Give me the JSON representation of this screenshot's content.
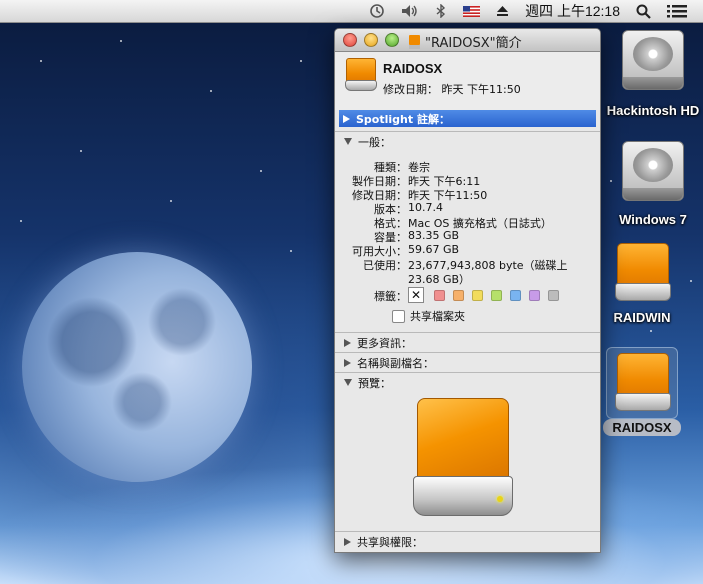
{
  "menubar": {
    "icons": [
      "time-machine-icon",
      "volume-icon",
      "bluetooth-icon",
      "us-flag-icon",
      "eject-icon",
      "spotlight-search-icon",
      "notification-list-icon"
    ],
    "clock": "週四 上午12:18"
  },
  "desktop": {
    "icons": [
      {
        "label": "Hackintosh HD",
        "kind": "internal-hdd"
      },
      {
        "label": "Windows 7",
        "kind": "internal-hdd"
      },
      {
        "label": "RAIDWIN",
        "kind": "external-drive"
      },
      {
        "label": "RAIDOSX",
        "kind": "external-drive",
        "selected": true
      }
    ]
  },
  "window": {
    "title": "\"RAIDOSX\"簡介",
    "name": "RAIDOSX",
    "modified": "修改日期： 昨天 下午11:50",
    "spotlight": "Spotlight 註解：",
    "general": {
      "header": "一般：",
      "rows": [
        {
          "k": "種類：",
          "v": "卷宗"
        },
        {
          "k": "製作日期：",
          "v": "昨天 下午6:11"
        },
        {
          "k": "修改日期：",
          "v": "昨天 下午11:50"
        },
        {
          "k": "版本：",
          "v": "10.7.4"
        },
        {
          "k": "格式：",
          "v": "Mac OS 擴充格式（日誌式）"
        },
        {
          "k": "容量：",
          "v": "83.35 GB"
        },
        {
          "k": "可用大小：",
          "v": "59.67 GB"
        },
        {
          "k": "已使用：",
          "v": "23,677,943,808 byte（磁碟上"
        },
        {
          "k": "",
          "v": "23.68 GB）"
        }
      ],
      "tags_label": "標籤：",
      "tag_colors": [
        "#f08f8f",
        "#f6b06a",
        "#f2dc5c",
        "#b6e06a",
        "#79b4f0",
        "#c79be8",
        "#bcbcbc"
      ],
      "shared_label": "共享檔案夾"
    },
    "more_info": "更多資訊：",
    "name_ext": "名稱與副檔名：",
    "preview": "預覽：",
    "sharing": "共享與權限："
  }
}
